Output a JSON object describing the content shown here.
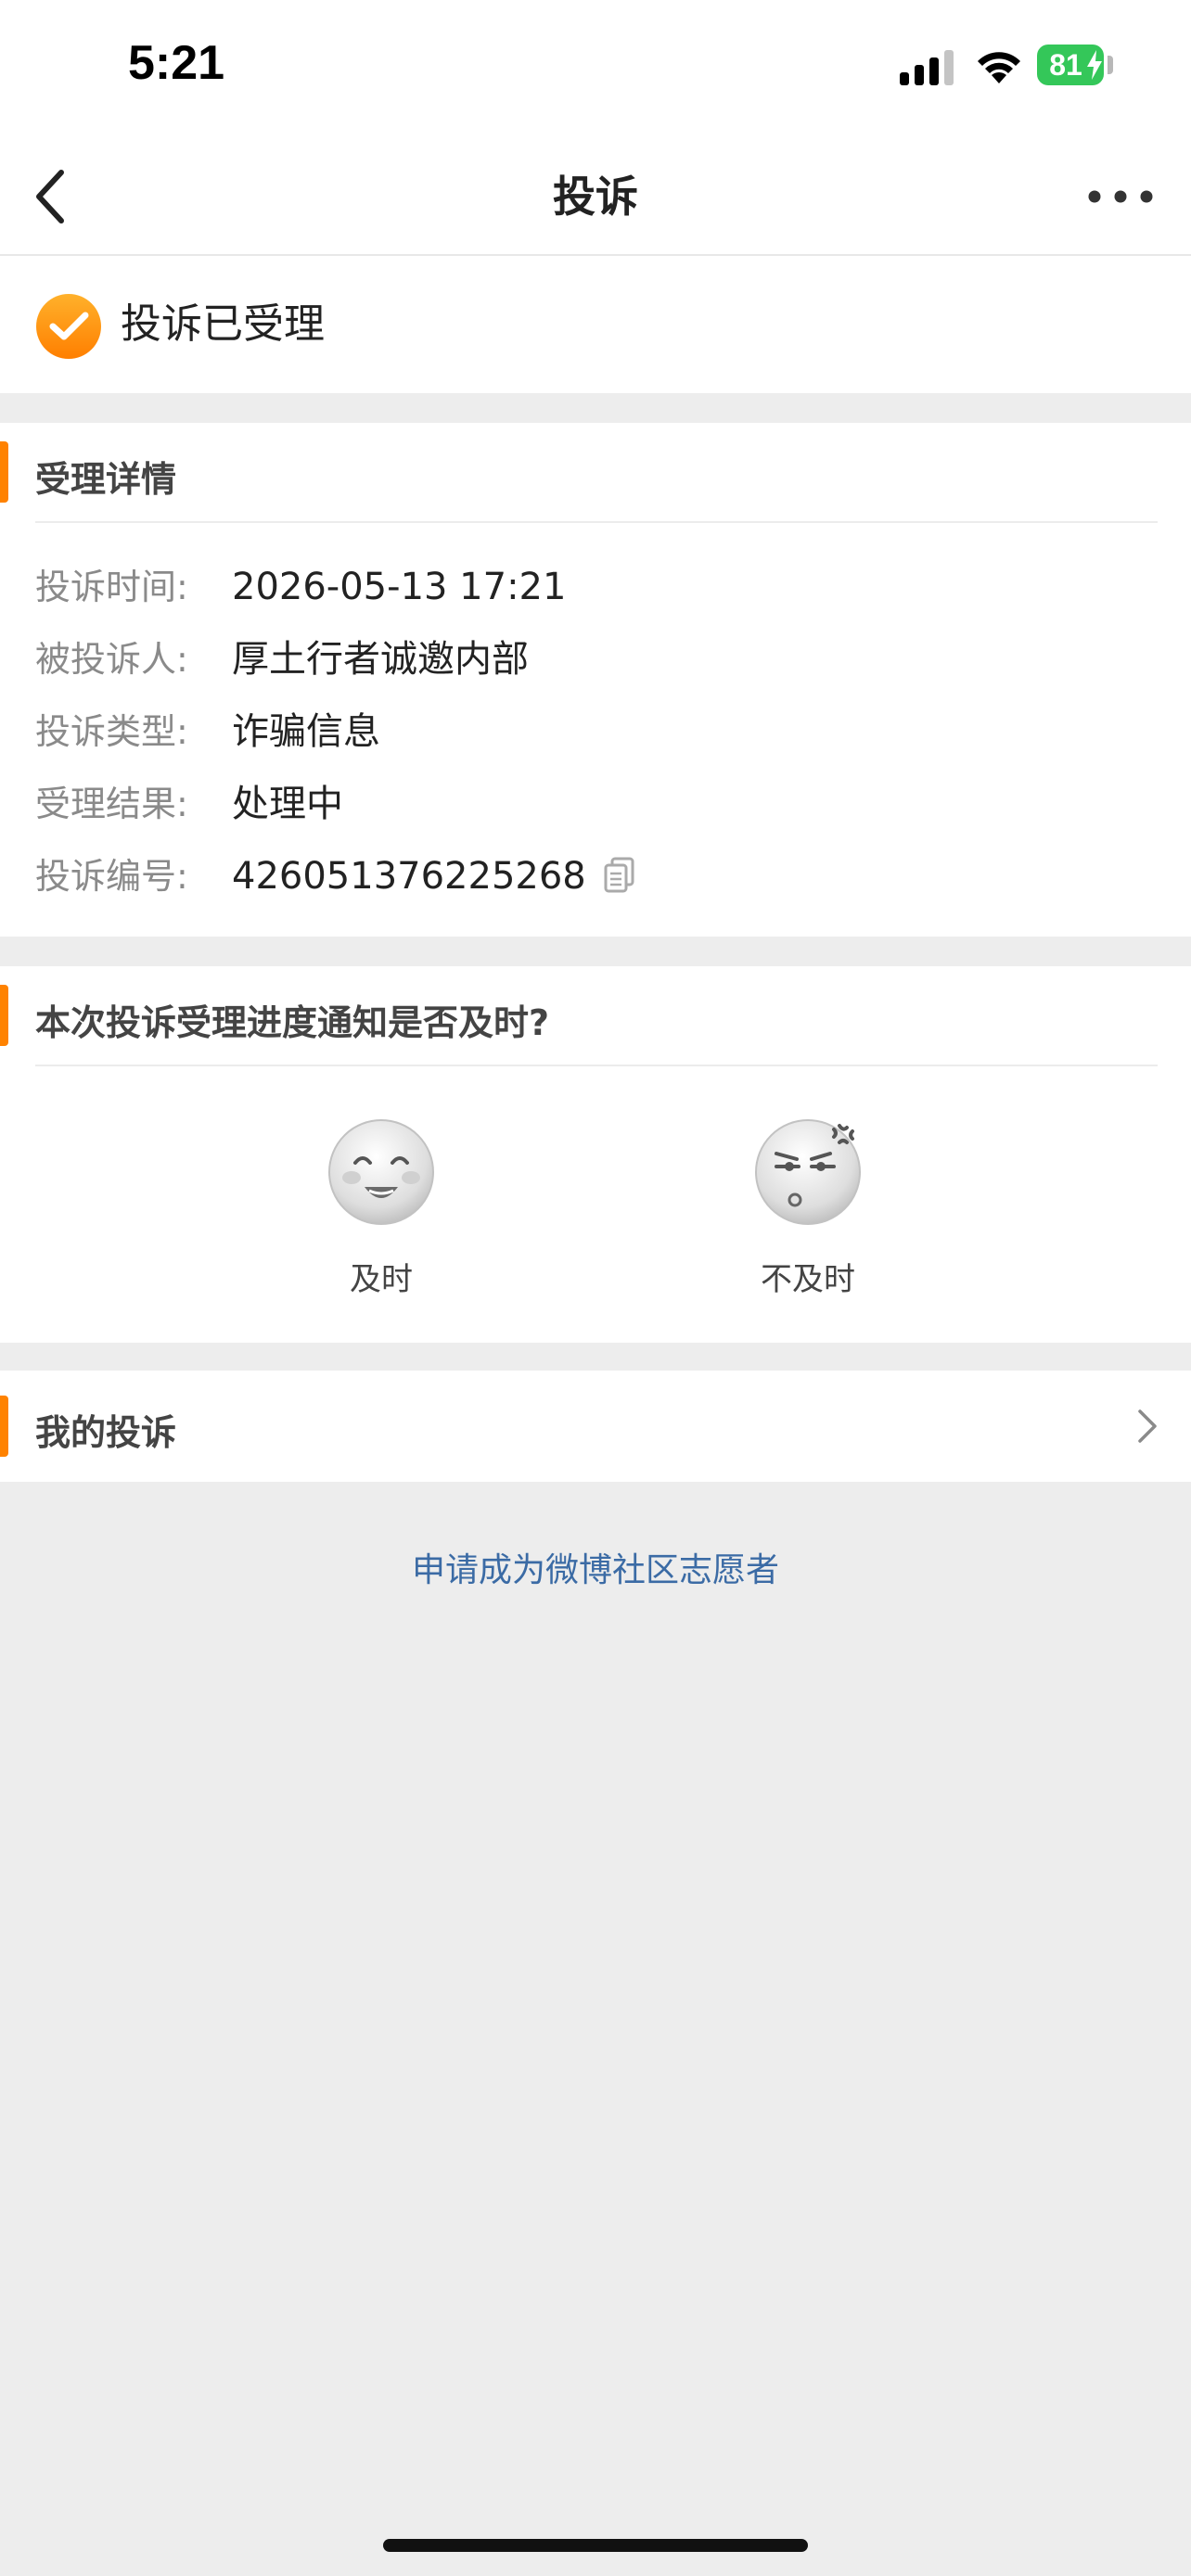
{
  "status_bar": {
    "time": "5:21",
    "battery": "81"
  },
  "nav": {
    "title": "投诉",
    "back_icon": "chevron-left-icon",
    "more_icon": "more-horizontal-icon"
  },
  "status": {
    "text": "投诉已受理",
    "icon": "check-circle-icon",
    "icon_color": "#ff8c00"
  },
  "details": {
    "title": "受理详情",
    "rows": [
      {
        "label": "投诉时间:",
        "value": "2026-05-13 17:21"
      },
      {
        "label": "被投诉人:",
        "value": "厚土行者诚邀内部"
      },
      {
        "label": "投诉类型:",
        "value": "诈骗信息"
      },
      {
        "label": "受理结果:",
        "value": "处理中"
      },
      {
        "label": "投诉编号:",
        "value": "426051376225268"
      }
    ]
  },
  "feedback": {
    "question": "本次投诉受理进度通知是否及时?",
    "options": [
      {
        "label": "及时",
        "icon": "smile-face-icon"
      },
      {
        "label": "不及时",
        "icon": "annoyed-face-icon"
      }
    ]
  },
  "my_complaints": {
    "label": "我的投诉"
  },
  "volunteer_link": "申请成为微博社区志愿者",
  "colors": {
    "accent": "#ff8200",
    "link": "#3b6ba5",
    "background": "#ededed"
  }
}
